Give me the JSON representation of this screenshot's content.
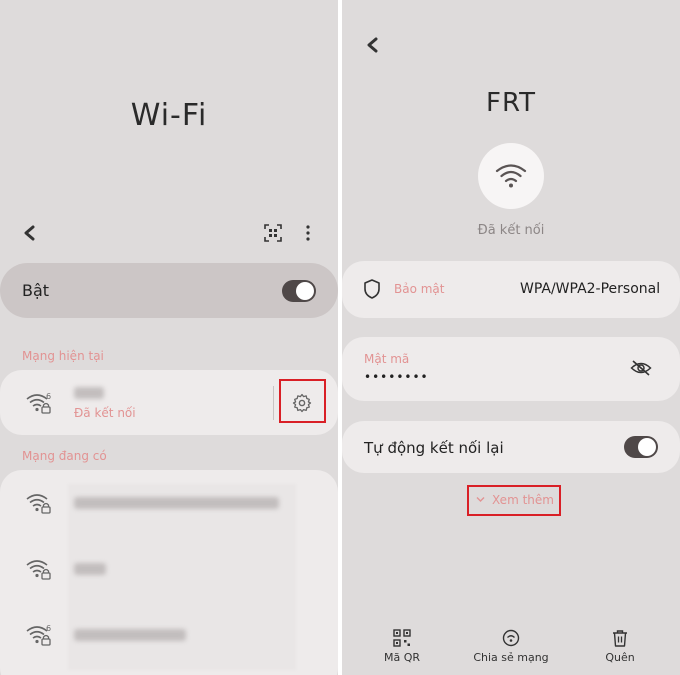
{
  "left": {
    "title": "Wi-Fi",
    "back_icon": "chevron-left-icon",
    "qr_scan_icon": "qr-scan-icon",
    "more_icon": "more-vertical-icon",
    "toggle": {
      "label": "Bật",
      "on": true
    },
    "current_section": "Mạng hiện tại",
    "current_network": {
      "status": "Đã kết nối",
      "icon": "wifi-6-lock-icon",
      "settings_icon": "gear-icon"
    },
    "available_section": "Mạng đang có",
    "available_networks": [
      {
        "icon": "wifi-lock-icon"
      },
      {
        "icon": "wifi-lock-icon"
      },
      {
        "icon": "wifi-6-lock-icon"
      }
    ]
  },
  "right": {
    "back_icon": "chevron-left-icon",
    "network_name": "FRT",
    "status": "Đã kết nối",
    "security": {
      "label": "Bảo mật",
      "value": "WPA/WPA2-Personal",
      "icon": "shield-icon"
    },
    "password": {
      "label": "Mật mã",
      "value": "••••••••",
      "icon": "eye-hidden-icon"
    },
    "auto_reconnect": {
      "label": "Tự động kết nối lại",
      "on": true
    },
    "see_more": "Xem thêm",
    "bottom_actions": [
      {
        "label": "Mã QR",
        "icon": "qr-code-icon"
      },
      {
        "label": "Chia sẻ mạng",
        "icon": "share-network-icon"
      },
      {
        "label": "Quên",
        "icon": "trash-icon"
      }
    ]
  },
  "colors": {
    "accent_pink": "#e29393",
    "highlight_red": "#d91f26",
    "panel_bg": "#dedbdb",
    "card_bg": "#eeebeb"
  }
}
